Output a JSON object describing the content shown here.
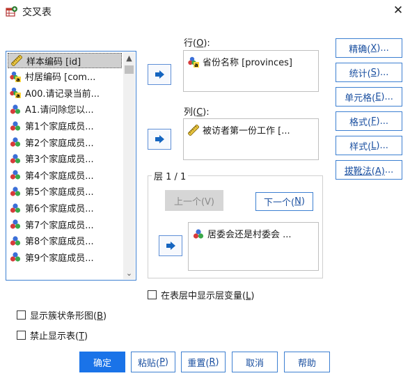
{
  "window": {
    "title": "交叉表",
    "close_glyph": "✕"
  },
  "colors": {
    "accent": "#3c7fd1",
    "primary_button": "#1a73e8",
    "arrow": "#1565c0"
  },
  "variable_list": {
    "items": [
      {
        "label": "样本编码 [id]",
        "icon": "ruler-scale-icon",
        "selected": true
      },
      {
        "label": "村居编码 [com...",
        "icon": "nominal-string-icon"
      },
      {
        "label": "A00.请记录当前...",
        "icon": "nominal-string-icon"
      },
      {
        "label": "A1.请问除您以...",
        "icon": "nominal-icon"
      },
      {
        "label": "第1个家庭成员...",
        "icon": "nominal-icon"
      },
      {
        "label": "第2个家庭成员...",
        "icon": "nominal-icon"
      },
      {
        "label": "第3个家庭成员...",
        "icon": "nominal-icon"
      },
      {
        "label": "第4个家庭成员...",
        "icon": "nominal-icon"
      },
      {
        "label": "第5个家庭成员...",
        "icon": "nominal-icon"
      },
      {
        "label": "第6个家庭成员...",
        "icon": "nominal-icon"
      },
      {
        "label": "第7个家庭成员...",
        "icon": "nominal-icon"
      },
      {
        "label": "第8个家庭成员...",
        "icon": "nominal-icon"
      },
      {
        "label": "第9个家庭成员...",
        "icon": "nominal-icon"
      }
    ]
  },
  "rows_box": {
    "label": "行(",
    "label_key": "O",
    "label_end": "):",
    "item": "省份名称 [provinces]",
    "item_icon": "nominal-string-icon"
  },
  "cols_box": {
    "label": "列(",
    "label_key": "C",
    "label_end": "):",
    "item": "被访者第一份工作 [...",
    "item_icon": "ruler-scale-icon"
  },
  "layer": {
    "label": "层 1 / 1",
    "prev_button": "上一个(V)",
    "next_button_pre": "下一个(",
    "next_button_key": "N",
    "next_button_end": ")",
    "item": "居委会还是村委会 ...",
    "item_icon": "nominal-icon"
  },
  "side_buttons": {
    "exact": {
      "pre": "精确(",
      "key": "X",
      "end": ")..."
    },
    "statistics": {
      "pre": "统计(",
      "key": "S",
      "end": ")..."
    },
    "cells": {
      "pre": "单元格(",
      "key": "E",
      "end": ")..."
    },
    "format": {
      "pre": "格式(",
      "key": "F",
      "end": ")..."
    },
    "style": {
      "pre": "样式(",
      "key": "L",
      "end": ")..."
    },
    "bootstrap": {
      "pre": "",
      "key": "拔靴法(A)",
      "end": "..."
    }
  },
  "checkboxes": {
    "show_layer": {
      "pre": "在表层中显示层变量(",
      "key": "L",
      "end": ")"
    },
    "clustered_bar": {
      "pre": "显示簇状条形图(",
      "key": "B",
      "end": ")"
    },
    "suppress_tables": {
      "pre": "禁止显示表(",
      "key": "T",
      "end": ")"
    }
  },
  "bottom_buttons": {
    "ok": "确定",
    "paste": {
      "pre": "粘贴(",
      "key": "P",
      "end": ")"
    },
    "reset": {
      "pre": "重置(",
      "key": "R",
      "end": ")"
    },
    "cancel": "取消",
    "help": "帮助"
  }
}
